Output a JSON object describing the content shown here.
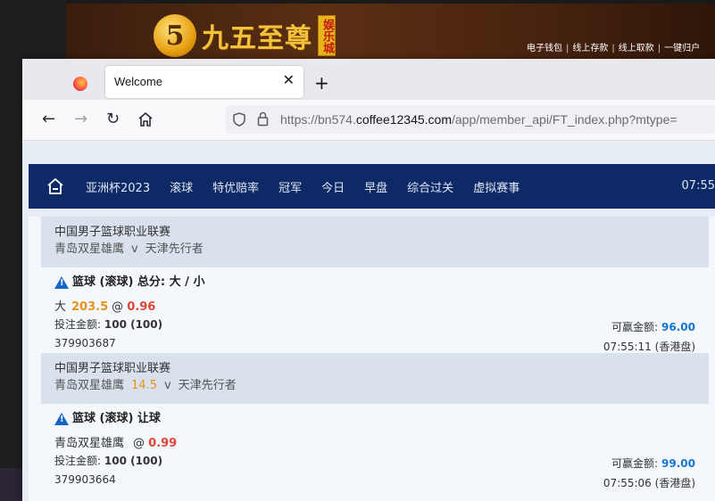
{
  "background_site": {
    "logo_mark": "5",
    "logo_text": "九五至尊",
    "logo_badge": "娱乐城",
    "links": [
      "电子钱包",
      "线上存款",
      "线上取款",
      "一键归户"
    ]
  },
  "browser": {
    "tab_title": "Welcome",
    "tab_close": "✕",
    "new_tab": "+",
    "url_prefix": "https://bn574.",
    "url_host": "coffee12345.com",
    "url_path": "/app/member_api/FT_index.php?mtype="
  },
  "site_nav": {
    "items": [
      "亚洲杯2023",
      "滚球",
      "特优赔率",
      "冠军",
      "今日",
      "早盘",
      "综合过关",
      "虚拟赛事"
    ],
    "time": "07:55"
  },
  "bets": [
    {
      "league": "中国男子篮球职业联赛",
      "home": "青岛双星雄鹰",
      "handicap": "",
      "vs": "v",
      "away": "天津先行者",
      "title": "篮球 (滚球) 总分: 大 / 小",
      "selection": "大",
      "line": "203.5",
      "at": "@",
      "odds": "0.96",
      "stake_label": "投注金额:",
      "stake_value": "100 (100)",
      "win_label": "可赢金额:",
      "win_value": "96.00",
      "ticket_id": "379903687",
      "time": "07:55:11 (香港盘)"
    },
    {
      "league": "中国男子篮球职业联赛",
      "home": "青岛双星雄鹰",
      "handicap": "14.5",
      "vs": "v",
      "away": "天津先行者",
      "title": "篮球 (滚球) 让球",
      "selection": "青岛双星雄鹰",
      "line": "",
      "at": "@",
      "odds": "0.99",
      "stake_label": "投注金额:",
      "stake_value": "100 (100)",
      "win_label": "可赢金额:",
      "win_value": "99.00",
      "ticket_id": "379903664",
      "time": "07:55:06 (香港盘)"
    }
  ]
}
